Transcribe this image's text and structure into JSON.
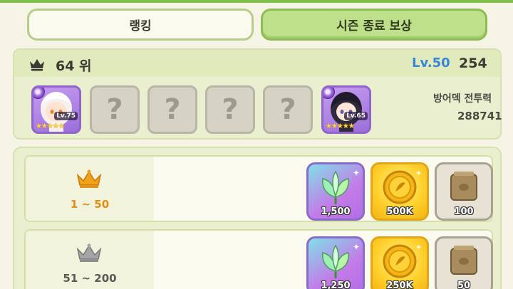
{
  "tabs": [
    {
      "label": "랭킹",
      "active": false
    },
    {
      "label": "시즌 종료 보상",
      "active": true
    }
  ],
  "ranking": {
    "rank_label": "64 위",
    "level": "Lv.50",
    "score": "254",
    "power_label": "방어덱 전투력",
    "power_value": "288741",
    "slots": [
      {
        "type": "character",
        "level": "Lv.75",
        "stars": "★★★★★"
      },
      {
        "type": "locked",
        "symbol": "?"
      },
      {
        "type": "locked",
        "symbol": "?"
      },
      {
        "type": "locked",
        "symbol": "?"
      },
      {
        "type": "locked",
        "symbol": "?"
      },
      {
        "type": "character",
        "level": "Lv.65",
        "stars": "★★★★★"
      }
    ]
  },
  "rewards": [
    {
      "tier": "1 ~ 50",
      "tier_icon": "gold-crown-icon",
      "items": [
        {
          "icon": "crystal-leaf-icon",
          "qty": "1,500"
        },
        {
          "icon": "gold-coin-icon",
          "qty": "500K"
        },
        {
          "icon": "stone-chest-icon",
          "qty": "100"
        }
      ]
    },
    {
      "tier": "51 ~ 200",
      "tier_icon": "silver-crown-icon",
      "items": [
        {
          "icon": "crystal-leaf-icon",
          "qty": "1,250"
        },
        {
          "icon": "gold-coin-icon",
          "qty": "250K"
        },
        {
          "icon": "stone-chest-icon",
          "qty": "50"
        }
      ]
    }
  ],
  "colors": {
    "accent_green": "#bfe08b",
    "level_blue": "#3a85d6",
    "gold_crown": "#f2a21a",
    "silver_crown": "#9a9a9a"
  }
}
